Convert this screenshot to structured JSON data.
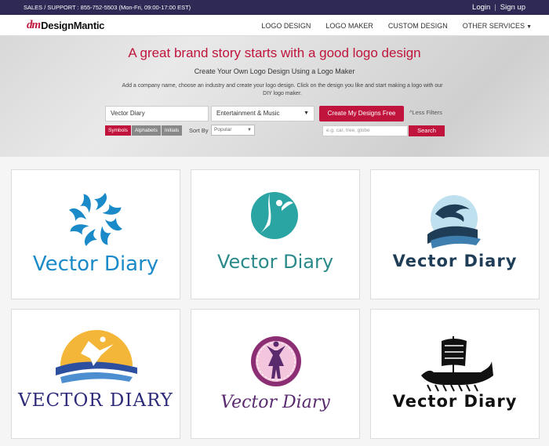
{
  "topbar": {
    "support": "SALES / SUPPORT : 855-752-5503 (Mon-Fri, 09:00-17:00 EST)",
    "login": "Login",
    "separator": "|",
    "signup": "Sign up"
  },
  "brand": {
    "mark": "dm",
    "name": "DesignMantic"
  },
  "nav": {
    "items": [
      "LOGO DESIGN",
      "LOGO MAKER",
      "CUSTOM DESIGN",
      "OTHER SERVICES"
    ]
  },
  "hero": {
    "headline": "A great brand story starts with a good logo design",
    "subheadline": "Create Your Own Logo Design Using a Logo Maker",
    "description": "Add a company name, choose an industry and create your logo design. Click on the design you like and start making a logo with our DIY logo maker."
  },
  "form": {
    "company_value": "Vector Diary",
    "industry_value": "Entertainment & Music",
    "create_label": "Create My Designs Free",
    "less_filters": "Less Filters",
    "filter_chips": [
      "Symbols",
      "Alphabets",
      "Initials"
    ],
    "active_chip": "Symbols",
    "sort_label": "Sort By",
    "sort_value": "Popular",
    "search_placeholder": "e.g. car, tree, globe",
    "search_label": "Search"
  },
  "designs": [
    {
      "name": "Vector Diary",
      "icon": "dolphin-ring-icon",
      "color": "#1a8ac8"
    },
    {
      "name": "Vector Diary",
      "icon": "fairy-circle-icon",
      "color": "#2aa5a3"
    },
    {
      "name": "Vector Diary",
      "icon": "dolphin-wave-icon",
      "color": "#1f3d57"
    },
    {
      "name": "VECTOR DIARY",
      "icon": "dancer-sun-icon",
      "color": "#2d2a7a"
    },
    {
      "name": "Vector Diary",
      "icon": "ballerina-badge-icon",
      "color": "#5a2a6e"
    },
    {
      "name": "Vector Diary",
      "icon": "viking-ship-icon",
      "color": "#111111"
    }
  ],
  "colors": {
    "accent": "#c0143c",
    "topbar": "#2f2a55"
  }
}
